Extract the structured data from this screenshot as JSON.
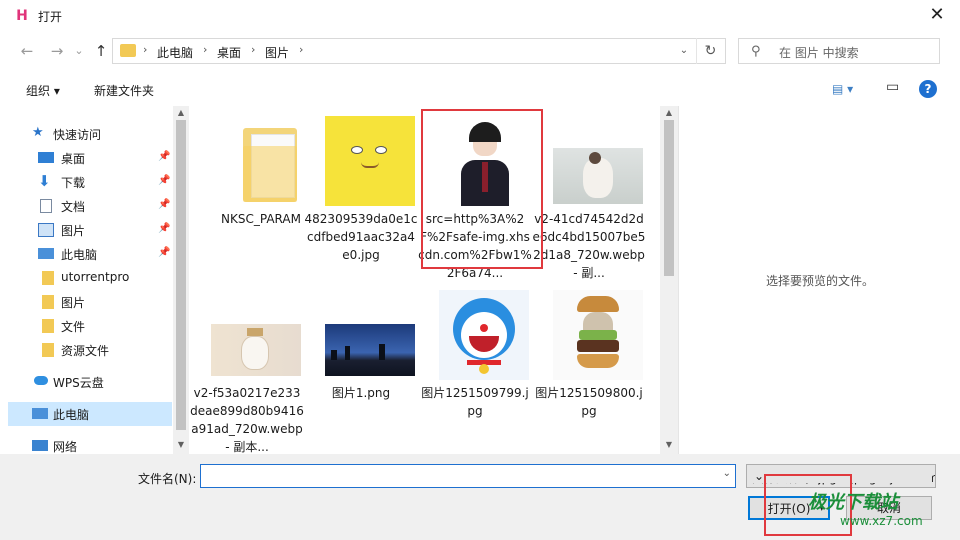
{
  "window": {
    "title": "打开",
    "close_label": "✕"
  },
  "nav": {
    "back": "←",
    "forward": "→",
    "dropdown": "⌄",
    "up": "↑"
  },
  "address": {
    "crumbs": [
      "此电脑",
      "桌面",
      "图片"
    ],
    "separator": "›",
    "dropdown": "⌄",
    "refresh": "↻"
  },
  "search": {
    "placeholder": "在 图片 中搜索",
    "icon": "⚲"
  },
  "toolbar": {
    "organize": "组织 ▾",
    "new_folder": "新建文件夹",
    "view_icon": "▤ ▾",
    "pane_icon": "▭",
    "help": "?"
  },
  "sidebar": {
    "items": [
      {
        "label": "快速访问",
        "icon": "star-icon",
        "pinned": false
      },
      {
        "label": "桌面",
        "icon": "desktop-icon",
        "pinned": true
      },
      {
        "label": "下载",
        "icon": "download-icon",
        "pinned": true
      },
      {
        "label": "文档",
        "icon": "document-icon",
        "pinned": true
      },
      {
        "label": "图片",
        "icon": "picture-icon",
        "pinned": true
      },
      {
        "label": "此电脑",
        "icon": "computer-icon",
        "pinned": true
      },
      {
        "label": "utorrentpro",
        "icon": "folder-icon",
        "pinned": false
      },
      {
        "label": "图片",
        "icon": "folder-icon",
        "pinned": false
      },
      {
        "label": "文件",
        "icon": "folder-icon",
        "pinned": false
      },
      {
        "label": "资源文件",
        "icon": "folder-icon",
        "pinned": false
      },
      {
        "label": "WPS云盘",
        "icon": "cloud-icon",
        "pinned": false
      },
      {
        "label": "此电脑",
        "icon": "computer-icon",
        "pinned": false,
        "selected": true
      },
      {
        "label": "网络",
        "icon": "network-icon",
        "pinned": false
      }
    ],
    "pin_glyph": "📌"
  },
  "files": [
    {
      "name": "NKSC_PARAM",
      "kind": "folder"
    },
    {
      "name": "482309539da0e1ccdfbed91aac32a4e0.jpg",
      "kind": "sponge"
    },
    {
      "name": "src=http%3A%2F%2Fsafe-img.xhscdn.com%2Fbw1%2F6a74...",
      "kind": "portrait"
    },
    {
      "name": "v2-41cd74542d2de6dc4bd15007be52d1a8_720w.webp - 副...",
      "kind": "photo-light"
    },
    {
      "name": "v2-f53a0217e233deae899d80b9416a91ad_720w.webp - 副本...",
      "kind": "bottle"
    },
    {
      "name": "图片1.png",
      "kind": "city"
    },
    {
      "name": "图片1251509799.jpg",
      "kind": "doraemon"
    },
    {
      "name": "图片1251509800.jpg",
      "kind": "burger"
    }
  ],
  "preview": {
    "text": "选择要预览的文件。"
  },
  "bottom": {
    "filename_label": "文件名(N):",
    "filename_value": "",
    "filter_value": "图像文件 (*.jpg *.jpeg *.jfif *.bmp",
    "open_label": "打开(O)",
    "open_dd": "▾",
    "cancel_label": "取消"
  },
  "watermark": {
    "brand": "极光下载站",
    "url": "www.xz7.com"
  },
  "colors": {
    "accent": "#0078d7",
    "highlight": "#e0393e",
    "selected": "#cce8ff"
  }
}
